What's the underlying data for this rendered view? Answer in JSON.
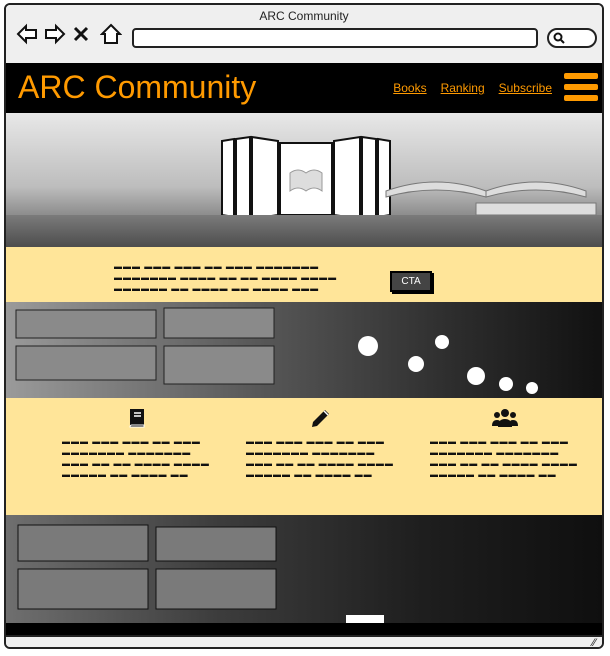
{
  "window": {
    "title": "ARC Community"
  },
  "browser": {
    "back_icon": "arrow-left-icon",
    "forward_icon": "arrow-right-icon",
    "close_icon": "close-icon",
    "home_icon": "home-icon",
    "url": "",
    "search_icon": "search-icon"
  },
  "header": {
    "brand": "ARC Community",
    "nav": [
      "Books",
      "Ranking",
      "Subscribe"
    ],
    "menu_icon": "hamburger-menu-icon"
  },
  "colors": {
    "accent": "#ff9a00",
    "band": "#ffe599",
    "header_bg": "#000000"
  },
  "intro": {
    "cta_label": "CTA"
  },
  "features": [
    {
      "icon": "book-icon"
    },
    {
      "icon": "pencil-icon"
    },
    {
      "icon": "users-icon"
    }
  ]
}
